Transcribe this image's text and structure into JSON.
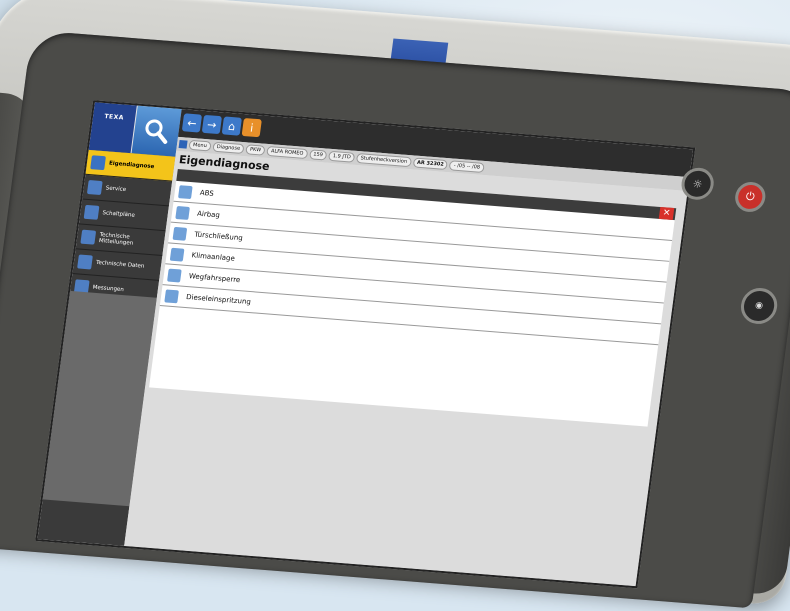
{
  "device": {
    "brand": "TEXA",
    "leds": [
      1,
      2,
      3,
      4,
      5
    ]
  },
  "app": {
    "logo": "TEXA",
    "toolbar": {
      "back_icon": "arrow-left-icon",
      "forward_icon": "arrow-right-icon",
      "home_icon": "home-icon",
      "info_icon": "info-icon"
    },
    "breadcrumb": [
      {
        "label": "Menu",
        "bold": false
      },
      {
        "label": "Diagnose",
        "bold": false
      },
      {
        "label": "PKW",
        "bold": false
      },
      {
        "label": "ALFA ROMEO",
        "bold": false
      },
      {
        "label": "159",
        "bold": false
      },
      {
        "label": "1.9 JTD",
        "bold": false
      },
      {
        "label": "Stufenheckversion",
        "bold": false
      },
      {
        "label": "AR 32302",
        "bold": true
      },
      {
        "label": "- /05 -- /08",
        "bold": false
      }
    ],
    "sidebar": [
      {
        "label": "Eigendiagnose",
        "active": true
      },
      {
        "label": "Service",
        "active": false
      },
      {
        "label": "Schaltpläne",
        "active": false
      },
      {
        "label": "Technische Mitteilungen",
        "active": false
      },
      {
        "label": "Technische Daten",
        "active": false
      },
      {
        "label": "Messungen",
        "active": false
      }
    ],
    "page_title": "Eigendiagnose",
    "systems": [
      {
        "label": "ABS",
        "icon": "abs-icon"
      },
      {
        "label": "Airbag",
        "icon": "airbag-icon"
      },
      {
        "label": "Türschließung",
        "icon": "door-lock-icon"
      },
      {
        "label": "Klimaanlage",
        "icon": "climate-icon"
      },
      {
        "label": "Wegfahrsperre",
        "icon": "immobilizer-icon"
      },
      {
        "label": "Dieseleinspritzung",
        "icon": "injection-icon"
      }
    ]
  }
}
